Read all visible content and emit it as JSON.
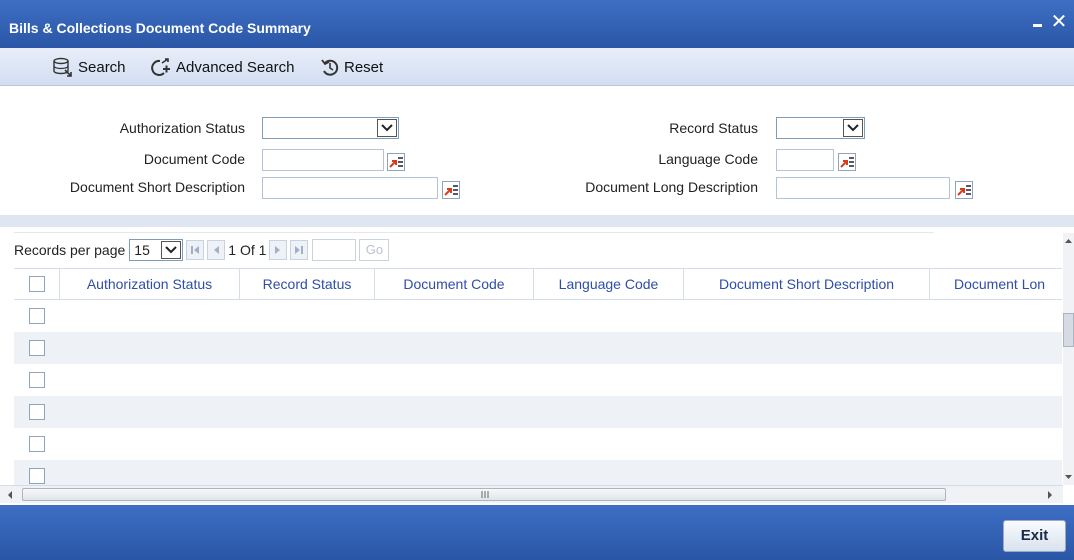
{
  "window": {
    "title": "Bills & Collections Document Code Summary",
    "minimize_label": "–",
    "close_label": "✕"
  },
  "toolbar": {
    "search_label": "Search",
    "advanced_search_label": "Advanced Search",
    "reset_label": "Reset"
  },
  "form": {
    "authorization_status_label": "Authorization Status",
    "record_status_label": "Record Status",
    "document_code_label": "Document Code",
    "language_code_label": "Language Code",
    "document_short_description_label": "Document Short Description",
    "document_long_description_label": "Document Long Description",
    "authorization_status_value": "",
    "record_status_value": "",
    "document_code_value": "",
    "language_code_value": "",
    "document_short_description_value": "",
    "document_long_description_value": ""
  },
  "pager": {
    "records_per_page_label": "Records per page",
    "records_per_page_value": "15",
    "page_info": "1 Of 1",
    "go_label": "Go"
  },
  "grid": {
    "columns": [
      "Authorization Status",
      "Record Status",
      "Document Code",
      "Language Code",
      "Document Short Description",
      "Document Lon"
    ],
    "row_count": 6
  },
  "footer": {
    "exit_label": "Exit"
  },
  "colors": {
    "titlebar": "#2a56a6",
    "header_text": "#2f4ea8",
    "lov_icon_red": "#d93c1a"
  }
}
